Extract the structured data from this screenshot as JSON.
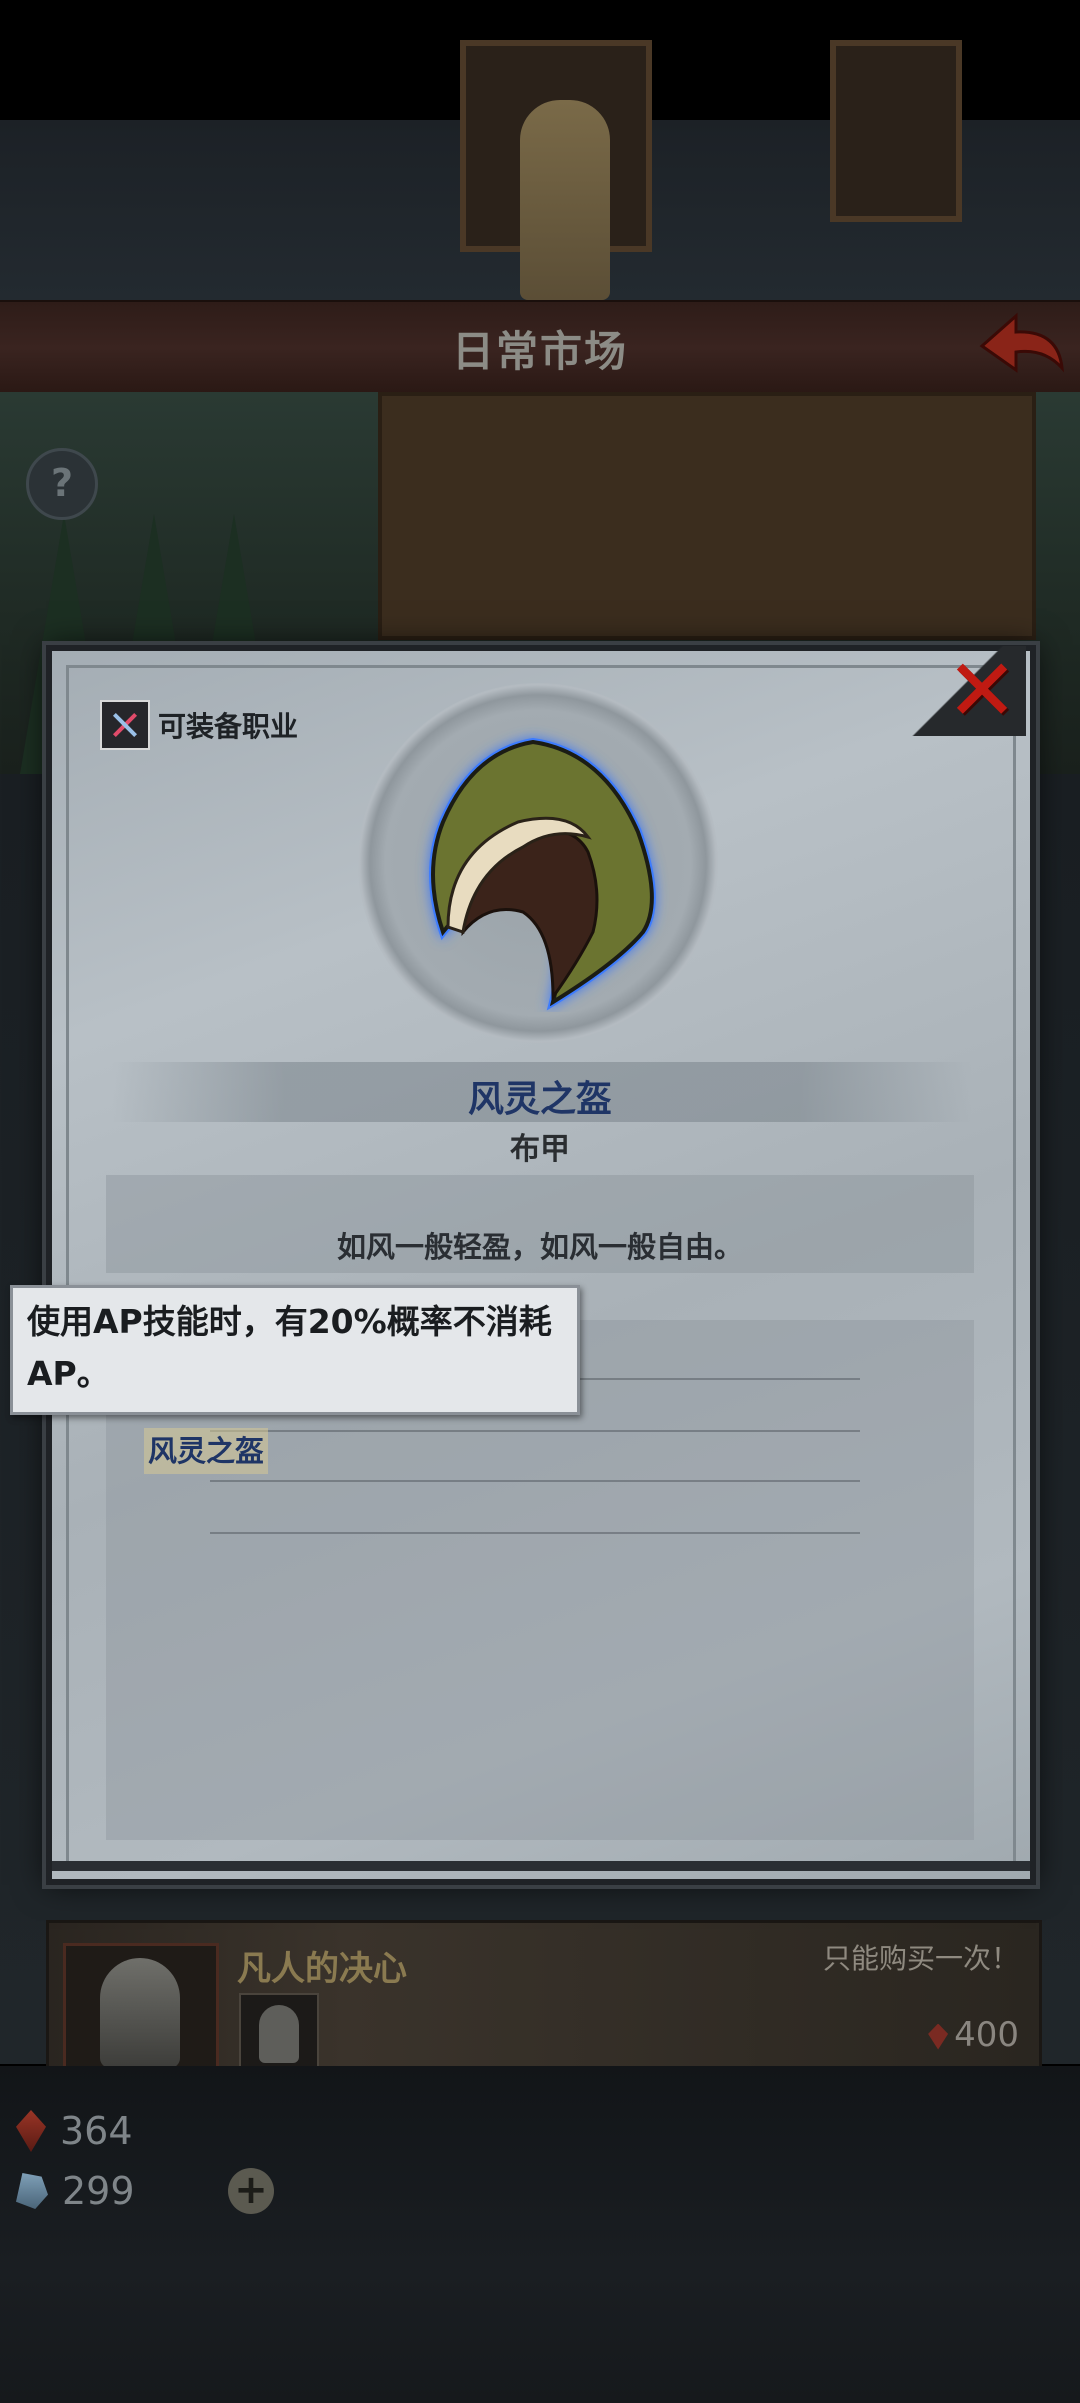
{
  "header": {
    "title": "日常市场"
  },
  "modal": {
    "class_label": "可装备职业",
    "item_name": "风灵之盔",
    "item_type": "布甲",
    "description": "如风一般轻盈，如风一般自由。",
    "set_tag": "风灵之盔",
    "tooltip": "使用AP技能时，有20%概率不消耗AP。"
  },
  "offer": {
    "title": "凡人的决心",
    "note": "只能购买一次！",
    "price": "400"
  },
  "currency": {
    "red_gems": "364",
    "blue_crystals": "299"
  },
  "colors": {
    "item_name": "#1f3566",
    "close_x": "#c01a12",
    "hood_glow": "#3c7cff"
  },
  "icons": [
    "back-arrow-icon",
    "help-icon",
    "close-icon",
    "class-icon",
    "hood-icon",
    "red-gem-icon",
    "blue-crystal-icon",
    "plus-icon"
  ]
}
